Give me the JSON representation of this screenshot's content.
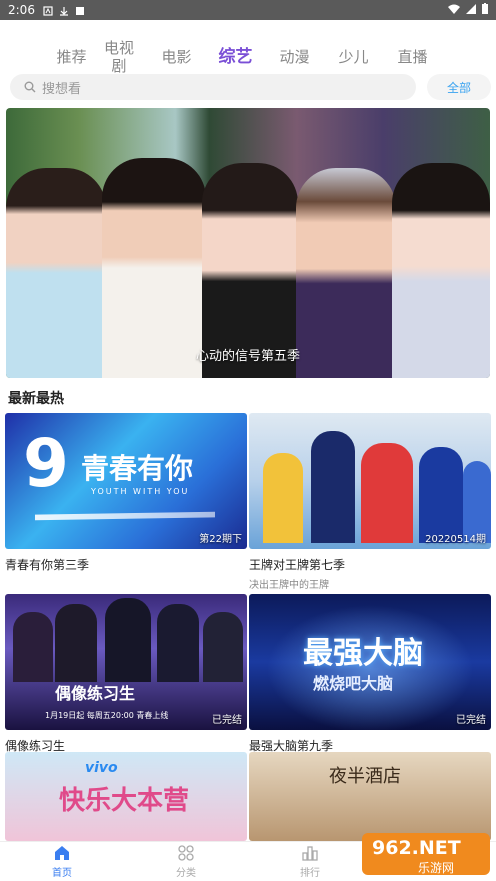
{
  "statusbar": {
    "time": "2:06"
  },
  "tabs": [
    "推荐",
    "电视剧",
    "电影",
    "综艺",
    "动漫",
    "少儿",
    "直播"
  ],
  "search": {
    "placeholder": "搜想看",
    "all_label": "全部"
  },
  "banner": {
    "title": "心动的信号第五季"
  },
  "section_title": "最新最热",
  "cards": [
    {
      "title": "青春有你第三季",
      "subtitle": "",
      "badge": "第22期下",
      "art_text": "青春有你",
      "art_sub": "YOUTH WITH YOU"
    },
    {
      "title": "王牌对王牌第七季",
      "subtitle": "决出王牌中的王牌",
      "badge": "20220514期",
      "art_text": "",
      "art_sub": ""
    },
    {
      "title": "偶像练习生",
      "subtitle": "",
      "badge": "已完结",
      "art_text": "偶像练习生",
      "art_sub": "1月19日起 每周五20:00 青春上线"
    },
    {
      "title": "最强大脑第九季",
      "subtitle": "",
      "badge": "已完结",
      "art_text": "最强大脑",
      "art_sub": "燃烧吧大脑"
    },
    {
      "title": "",
      "subtitle": "",
      "badge": "",
      "art_text": "快乐大本营",
      "art_sub": "vivo"
    },
    {
      "title": "",
      "subtitle": "",
      "badge": "",
      "art_text": "夜半酒店",
      "art_sub": ""
    }
  ],
  "nav": [
    {
      "label": "首页",
      "icon": "home-icon",
      "active": true
    },
    {
      "label": "分类",
      "icon": "category-icon",
      "active": false
    },
    {
      "label": "排行",
      "icon": "ranking-icon",
      "active": false
    },
    {
      "label": "",
      "icon": "",
      "active": false
    }
  ],
  "watermark": {
    "text": "962.NET",
    "sub": "乐游网"
  },
  "colors": {
    "accent": "#7a4fd6",
    "link": "#3aa3f0",
    "nav_active": "#3a7ef0"
  }
}
